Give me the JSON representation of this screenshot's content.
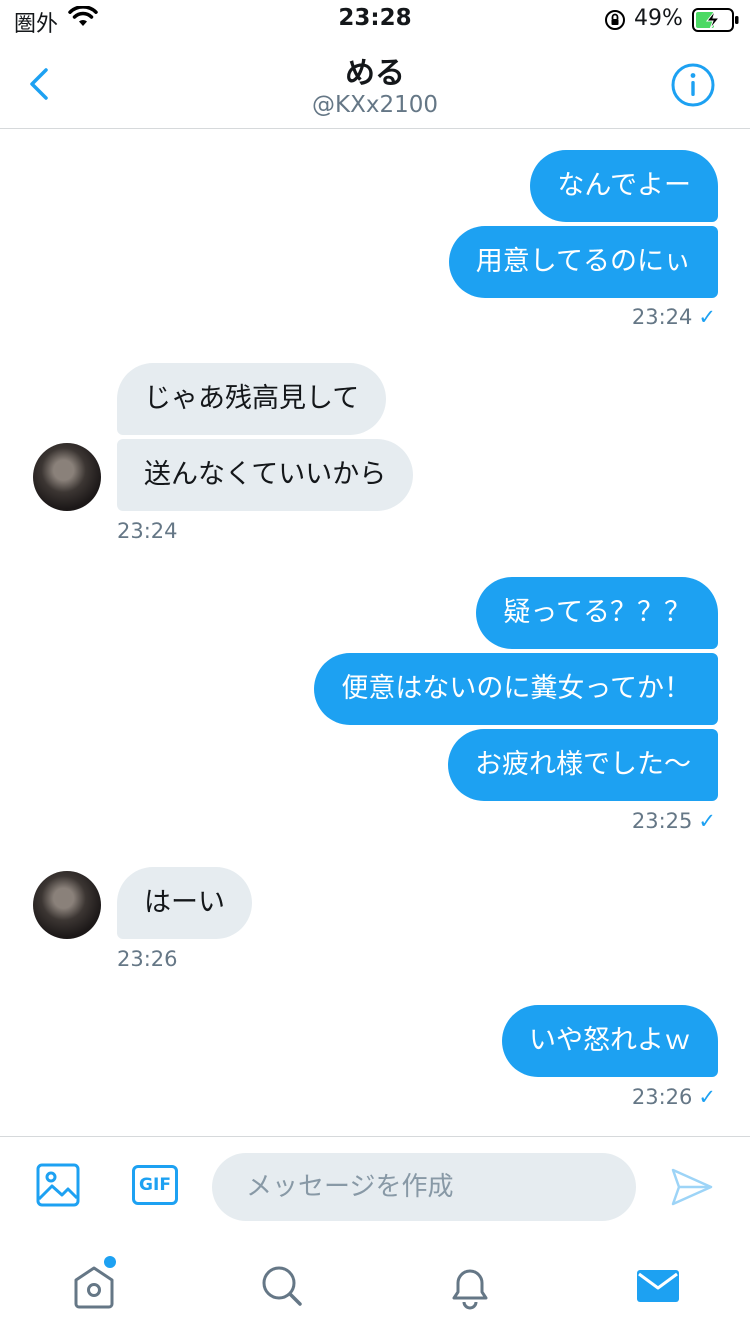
{
  "status_bar": {
    "carrier": "圏外",
    "time": "23:28",
    "battery_percent": "49%"
  },
  "header": {
    "name": "める",
    "handle": "@KXx2100"
  },
  "conversation": {
    "groups": [
      {
        "direction": "outgoing",
        "messages": [
          "なんでよー",
          "用意してるのにぃ"
        ],
        "time": "23:24",
        "read_check": "✓"
      },
      {
        "direction": "incoming",
        "messages": [
          "じゃあ残高見して",
          "送んなくていいから"
        ],
        "time": "23:24"
      },
      {
        "direction": "outgoing",
        "messages": [
          "疑ってる？？？",
          "便意はないのに糞女ってか！",
          "お疲れ様でした〜"
        ],
        "time": "23:25",
        "read_check": "✓"
      },
      {
        "direction": "incoming",
        "messages": [
          "はーい"
        ],
        "time": "23:26"
      },
      {
        "direction": "outgoing",
        "messages": [
          "いや怒れよｗ"
        ],
        "time": "23:26",
        "read_check": "✓"
      }
    ]
  },
  "composer": {
    "placeholder": "メッセージを作成",
    "gif_label": "GIF"
  },
  "colors": {
    "accent": "#1da1f2",
    "incoming_bubble": "#e6ecf0",
    "secondary_text": "#657786"
  },
  "icons": {
    "back": "chevron-left-icon",
    "info": "info-icon",
    "media": "image-icon",
    "gif": "gif-icon",
    "send": "send-icon",
    "home": "home-icon",
    "search": "search-icon",
    "notifications": "bell-icon",
    "messages": "mail-icon"
  }
}
